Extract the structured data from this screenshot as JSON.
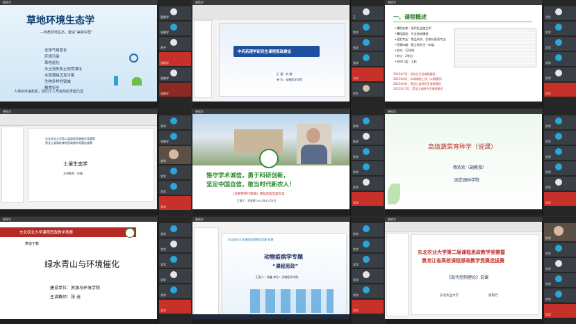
{
  "colors": {
    "bg": "#2a2a2a",
    "tile_bar": "#3a3a3a",
    "red_badge": "#c8302a",
    "green": "#4aa84a",
    "teal": "#1a8fb0"
  },
  "window_labels": {
    "t1": "更换学",
    "t2": "更换学",
    "t3": "更换学",
    "t4": "更换学",
    "t5": "更换学",
    "t6": "更换学",
    "t7": "更换学",
    "t8": "更换学",
    "t9": "更换学"
  },
  "p1": {
    "title": "草地环境生态学",
    "subtitle": "—熟悉草地生态，建设“美丽中国”",
    "lines": [
      "全球气候变化",
      "环境污染",
      "草地退化",
      "水土流失和土地荒漠化",
      "水资源缺乏及污染",
      "生物多样性锐减",
      "粮食安全"
    ],
    "foot": "人类的环境危机，回归了人与自然的矛盾凸显"
  },
  "p2": {
    "title": "中药药理学研究生课程思政建设",
    "author": "汇 报：刘 娜",
    "school": "单 位：动物医学学院"
  },
  "p3": {
    "heading": "一、课程概述",
    "items": [
      "•课程名称：现代乳品加工学",
      "•课程类别：专业选修课程",
      "•适用专业：食品科学、生物与医药专业",
      "•开课年级：硕士研究生一年级",
      "•学时：32学时",
      "•学分：2学分",
      "•学科门类：工科"
    ],
    "years": [
      "2019年7月：研究生开设课程建设",
      "2022年6月：申请课程上线（二期建设）",
      "2022年9月：黑龙江省研究生课程建设",
      "2022年11月：黑龙江省研究生课程建设"
    ]
  },
  "p4": {
    "head1": "东北农业大学第二届课程思政教学竞赛暨",
    "head2": "黑龙江省高校课程思政教学竞赛选拔赛",
    "title": "土壤生态学",
    "teacher": "主讲教师：孙晓"
  },
  "p5": {
    "slogan1": "恪守学术诚信，勇于科研创新，",
    "slogan2": "坚定中国自信，敢当时代新农人！",
    "course": "《动物营养代谢病》课程思政实施方案",
    "meta": "汇报人：李宏图    2022年12月3日"
  },
  "p6": {
    "title": "高级蔬菜育种学（说课）",
    "teacher": "杨欢欢（副教授）",
    "school": "园艺园林学院"
  },
  "p7": {
    "header": "东北农业大学课程思政教学竞赛",
    "sub": "寓道于教",
    "title": "绿水青山与环境催化",
    "unit": "建设单位：资源与环境学院",
    "teacher": "主讲教师：张    迪"
  },
  "p8": {
    "top": "东北农业大学课程思政教学竞赛·说课",
    "title": "动物疫病学专题",
    "subtitle": "“课程思政”",
    "info": "汇报人：周鑫    单位：动物医学学院"
  },
  "p9": {
    "l1": "东北农业大学第二届课程思政教学竞赛暨",
    "l2": "黑龙江省高校课程思政教学竞赛选拔赛",
    "course": "《现代控制理论》说课",
    "school": "东北农业大学",
    "teacher": "谌现行"
  },
  "participants": {
    "s1": [
      "更换学",
      "张晓学",
      "朱宇",
      "张晓学",
      "张晓学",
      "张晓学",
      "韩",
      "李晓学"
    ],
    "s2": [
      "王",
      "李学",
      "张学",
      "张学",
      "马学",
      "学生",
      "学学",
      "学学"
    ],
    "s3": [
      "学生",
      "学学",
      "学学",
      "学学",
      "学学",
      "学生",
      "学学",
      "学学"
    ],
    "s4": [
      "学学",
      "李晓学",
      "学学",
      "学学",
      "学学",
      "学学",
      "学学",
      "学学"
    ],
    "s5": [
      "学学",
      "张学",
      "学学",
      "学学",
      "学学",
      "学学",
      "学学",
      "学学"
    ],
    "s6": [
      "学学",
      "学学",
      "学学",
      "学学",
      "学学",
      "学学",
      "学学",
      "学学"
    ],
    "s7": [
      "学学",
      "学学",
      "学学",
      "学学",
      "学学",
      "学学",
      "学学",
      "学学"
    ],
    "s8": [
      "学学",
      "学学",
      "学学",
      "学学",
      "学学",
      "学学",
      "学学",
      "学学"
    ],
    "s9": [
      "学学",
      "学学",
      "学学",
      "学学",
      "学学",
      "学学",
      "学学",
      "学学"
    ]
  }
}
